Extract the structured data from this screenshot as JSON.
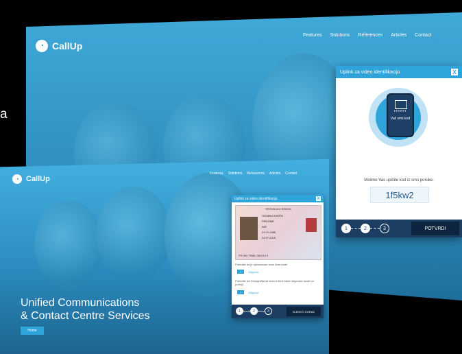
{
  "stray_text": "a",
  "back_site": {
    "brand": "CallUp",
    "nav": [
      "Features",
      "Solutions",
      "References",
      "Articles",
      "Contact"
    ]
  },
  "back_modal": {
    "title": "Uplink za video identifikaciju",
    "close": "X",
    "phone_dots": "••••••",
    "phone_label": "Vaš sms kod",
    "instruction": "Molimo Vas upišite kod iz sms poruke:",
    "code": "1f5kw2",
    "steps": [
      "1",
      "2",
      "3"
    ],
    "confirm": "POTVRDI"
  },
  "front_site": {
    "brand": "CallUp",
    "nav": [
      "Features",
      "Solutions",
      "References",
      "Articles",
      "Contact"
    ],
    "hero_line1": "Unified Communications",
    "hero_line2": "& Contact Centre Services",
    "hero_button": "Home"
  },
  "front_modal": {
    "title": "Uplink za video identifikaciju",
    "close": "X",
    "id_title": "REPUBLIKA SRBIJA",
    "id_lines": [
      "OSOBNA KARTA",
      "PREZIME",
      "IME",
      "24.12.1985",
      "24.07.2015"
    ],
    "id_mrz": "FR 084 TRAIL 081013 0",
    "q1": "Potvrdite da je uploadovan scan lične karte",
    "q2": "Potvrdite da li fotografija sa scan-a lične karte odgovara osobi na poziciji",
    "answer": "Odgovor",
    "steps": [
      "1",
      "2",
      "3"
    ],
    "next": "SLEDEĆI KORAK"
  }
}
